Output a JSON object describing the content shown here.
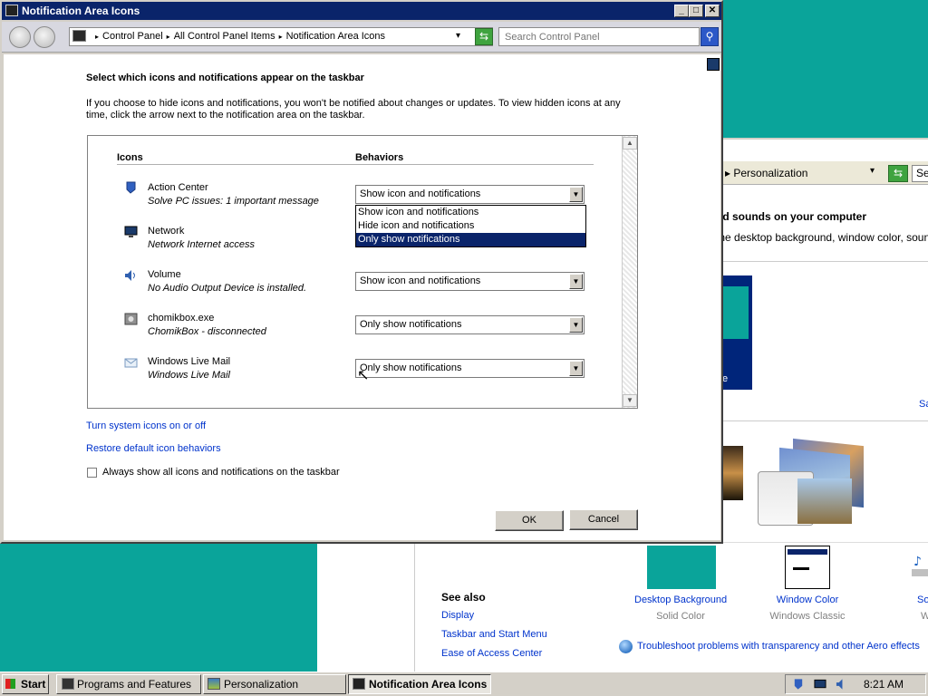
{
  "background_window": {
    "breadcrumb": "n ▸ Personalization",
    "search_fragment": "Se",
    "heading_fragment": "nd sounds on your computer",
    "sub_fragment": "the desktop background, window color, sounds",
    "preview_fragment": "e",
    "link_fragment": "Sa",
    "see_also": {
      "title": "See also",
      "links": [
        "Display",
        "Taskbar and Start Menu",
        "Ease of Access Center"
      ]
    },
    "items": [
      {
        "label": "Desktop Background",
        "value": "Solid Color"
      },
      {
        "label": "Window Color",
        "value": "Windows Classic"
      },
      {
        "label": "So",
        "value": "Windo"
      }
    ],
    "troubleshoot": "Troubleshoot problems with transparency and other Aero effects"
  },
  "window": {
    "title": "Notification Area Icons",
    "caption_buttons": {
      "min": "_",
      "max": "□",
      "close": "✕"
    },
    "address": {
      "crumbs": [
        "Control Panel",
        "All Control Panel Items",
        "Notification Area Icons"
      ],
      "separator": "▸",
      "dropdown": "▾"
    },
    "refresh_glyph": "⇆",
    "search": {
      "placeholder": "Search Control Panel",
      "button": "⚲"
    },
    "heading": "Select which icons and notifications appear on the taskbar",
    "description": "If you choose to hide icons and notifications, you won't be notified about changes or updates. To view hidden icons at any time, click the arrow next to the notification area on the taskbar.",
    "columns": {
      "icons": "Icons",
      "behaviors": "Behaviors"
    },
    "rows": [
      {
        "name": "Action Center",
        "desc": "Solve PC issues: 1 important message",
        "behavior": "Show icon and notifications"
      },
      {
        "name": "Network",
        "desc": "Network Internet access",
        "behavior": ""
      },
      {
        "name": "Volume",
        "desc": "No Audio Output Device is installed.",
        "behavior": "Show icon and notifications"
      },
      {
        "name": "chomikbox.exe",
        "desc": "ChomikBox - disconnected",
        "behavior": "Only show notifications"
      },
      {
        "name": "Windows Live Mail",
        "desc": "Windows Live Mail",
        "behavior": "Only show notifications"
      }
    ],
    "dropdown_options": [
      "Show icon and notifications",
      "Hide icon and notifications",
      "Only show notifications"
    ],
    "dropdown_selected": "Only show notifications",
    "combo_arrow": "▼",
    "scroll": {
      "up": "▲",
      "down": "▼"
    },
    "links": [
      "Turn system icons on or off",
      "Restore default icon behaviors"
    ],
    "checkbox": {
      "label": "Always show all icons and notifications on the taskbar",
      "checked": false
    },
    "buttons": {
      "ok": "OK",
      "cancel": "Cancel"
    }
  },
  "taskbar": {
    "start": "Start",
    "tasks": [
      "Programs and Features",
      "Personalization",
      "Notification Area Icons"
    ],
    "active_task": "Notification Area Icons",
    "clock": "8:21 AM"
  },
  "colors": {
    "desktop": "#0aa49a",
    "titlebar": "#0a246a",
    "link": "#0033cc",
    "selection": "#0a246a"
  }
}
